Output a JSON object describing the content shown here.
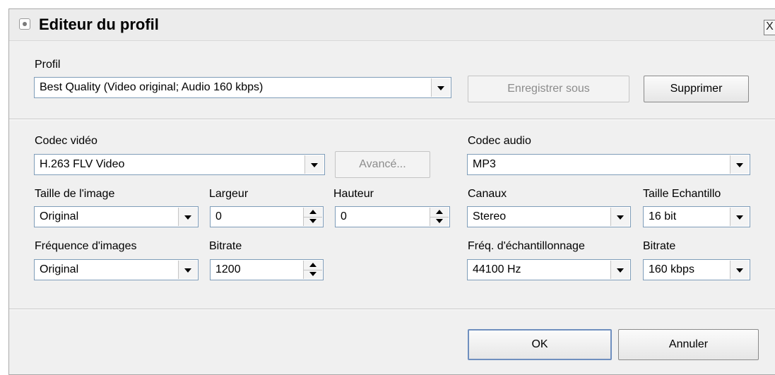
{
  "window": {
    "title": "Editeur du profil",
    "close_label": "X"
  },
  "profile": {
    "label": "Profil",
    "selected": "Best Quality (Video original; Audio 160 kbps)",
    "save_as_label": "Enregistrer sous",
    "delete_label": "Supprimer"
  },
  "video": {
    "codec_label": "Codec vidéo",
    "codec_value": "H.263 FLV Video",
    "advanced_label": "Avancé...",
    "size_label": "Taille de l'image",
    "size_value": "Original",
    "width_label": "Largeur",
    "width_value": "0",
    "height_label": "Hauteur",
    "height_value": "0",
    "fps_label": "Fréquence d'images",
    "fps_value": "Original",
    "bitrate_label": "Bitrate",
    "bitrate_value": "1200"
  },
  "audio": {
    "codec_label": "Codec audio",
    "codec_value": "MP3",
    "channels_label": "Canaux",
    "channels_value": "Stereo",
    "sample_size_label": "Taille Echantillo",
    "sample_size_value": "16 bit",
    "sample_rate_label": "Fréq. d'échantillonnage",
    "sample_rate_value": "44100 Hz",
    "bitrate_label": "Bitrate",
    "bitrate_value": "160 kbps"
  },
  "footer": {
    "ok_label": "OK",
    "cancel_label": "Annuler"
  }
}
